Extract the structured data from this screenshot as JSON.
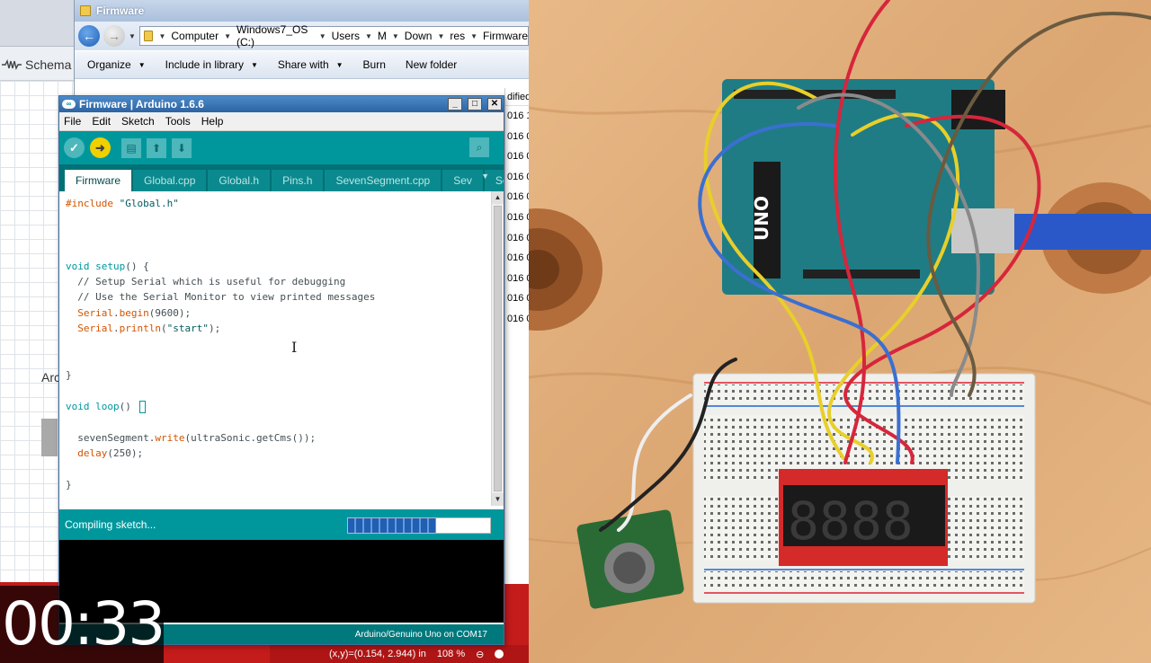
{
  "schematic": {
    "tab_label": "Schema",
    "side_text": "Arc"
  },
  "explorer": {
    "title": "Firmware",
    "breadcrumbs": [
      "Computer",
      "Windows7_OS (C:)",
      "Users",
      "M",
      "Down",
      "res",
      "Firmware"
    ],
    "toolbar": [
      {
        "label": "Organize",
        "has_menu": true
      },
      {
        "label": "Include in library",
        "has_menu": true
      },
      {
        "label": "Share with",
        "has_menu": true
      },
      {
        "label": "Burn",
        "has_menu": false
      },
      {
        "label": "New folder",
        "has_menu": false
      }
    ],
    "column_header": "dified",
    "rows": [
      "016 1",
      "016 0",
      "016 0",
      "016 0",
      "016 0",
      "016 0",
      "016 0",
      "016 0",
      "016 0",
      "016 0",
      "016 0"
    ]
  },
  "arduino": {
    "title": "Firmware | Arduino 1.6.6",
    "menu": [
      "File",
      "Edit",
      "Sketch",
      "Tools",
      "Help"
    ],
    "tabs": [
      "Firmware",
      "Global.cpp",
      "Global.h",
      "Pins.h",
      "SevenSegment.cpp",
      "Sev",
      "Se"
    ],
    "status_text": "Compiling sketch...",
    "progress": 0.62,
    "footer": "Arduino/Genuino Uno on COM17"
  },
  "status_bar": {
    "coords": "(x,y)=(0.154, 2.944) in",
    "zoom": "108 %"
  },
  "timer": "00:33",
  "colors": {
    "arduino_teal": "#00979c",
    "upload_yellow": "#f0d000",
    "schematic_red": "#c41b1b"
  }
}
